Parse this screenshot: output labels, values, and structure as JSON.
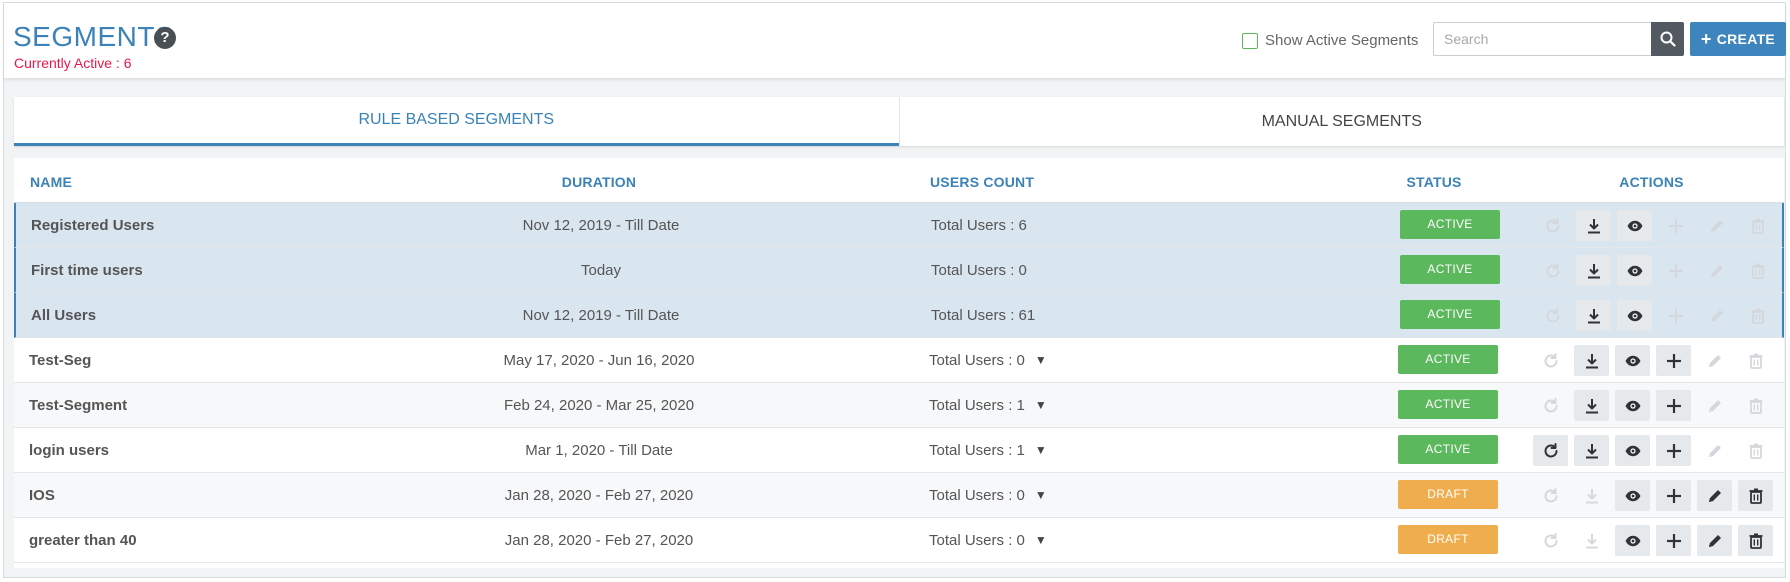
{
  "header": {
    "title": "SEGMENTS",
    "help": "?",
    "active_count_label": "Currently Active : 6",
    "show_active_label": "Show Active Segments",
    "search_placeholder": "Search",
    "create_label": "CREATE"
  },
  "tabs": [
    {
      "label": "RULE BASED SEGMENTS",
      "active": true
    },
    {
      "label": "MANUAL SEGMENTS",
      "active": false
    }
  ],
  "table": {
    "headers": {
      "name": "NAME",
      "duration": "DURATION",
      "users": "USERS COUNT",
      "status": "STATUS",
      "actions": "ACTIONS"
    },
    "rows": [
      {
        "name": "Registered Users",
        "duration": "Nov 12, 2019 - Till Date",
        "users": "Total Users : 6",
        "dropdown": false,
        "status": "ACTIVE",
        "selected": true,
        "actions": {
          "refresh": false,
          "download": true,
          "view": true,
          "add": false,
          "edit": false,
          "delete": false
        }
      },
      {
        "name": "First time users",
        "duration": "Today",
        "users": "Total Users : 0",
        "dropdown": false,
        "status": "ACTIVE",
        "selected": true,
        "actions": {
          "refresh": false,
          "download": true,
          "view": true,
          "add": false,
          "edit": false,
          "delete": false
        }
      },
      {
        "name": "All Users",
        "duration": "Nov 12, 2019 - Till Date",
        "users": "Total Users : 61",
        "dropdown": false,
        "status": "ACTIVE",
        "selected": true,
        "actions": {
          "refresh": false,
          "download": true,
          "view": true,
          "add": false,
          "edit": false,
          "delete": false
        }
      },
      {
        "name": "Test-Seg",
        "duration": "May 17, 2020 - Jun 16, 2020",
        "users": "Total Users : 0",
        "dropdown": true,
        "status": "ACTIVE",
        "selected": false,
        "actions": {
          "refresh": false,
          "download": true,
          "view": true,
          "add": true,
          "edit": false,
          "delete": false
        }
      },
      {
        "name": "Test-Segment",
        "duration": "Feb 24, 2020 - Mar 25, 2020",
        "users": "Total Users : 1",
        "dropdown": true,
        "status": "ACTIVE",
        "selected": false,
        "actions": {
          "refresh": false,
          "download": true,
          "view": true,
          "add": true,
          "edit": false,
          "delete": false
        }
      },
      {
        "name": "login users",
        "duration": "Mar 1, 2020 - Till Date",
        "users": "Total Users : 1",
        "dropdown": true,
        "status": "ACTIVE",
        "selected": false,
        "actions": {
          "refresh": true,
          "download": true,
          "view": true,
          "add": true,
          "edit": false,
          "delete": false
        }
      },
      {
        "name": "IOS",
        "duration": "Jan 28, 2020 - Feb 27, 2020",
        "users": "Total Users : 0",
        "dropdown": true,
        "status": "DRAFT",
        "selected": false,
        "actions": {
          "refresh": false,
          "download": false,
          "view": true,
          "add": true,
          "edit": true,
          "delete": true
        }
      },
      {
        "name": "greater than 40",
        "duration": "Jan 28, 2020 - Feb 27, 2020",
        "users": "Total Users : 0",
        "dropdown": true,
        "status": "DRAFT",
        "selected": false,
        "actions": {
          "refresh": false,
          "download": false,
          "view": true,
          "add": true,
          "edit": true,
          "delete": true
        }
      }
    ]
  },
  "icons": {
    "caret": "▼",
    "search": "search-icon",
    "plus": "+"
  },
  "colors": {
    "brand": "#3a82b7",
    "active": "#5cb85c",
    "draft": "#f0ad4e",
    "alert": "#e8194a"
  }
}
